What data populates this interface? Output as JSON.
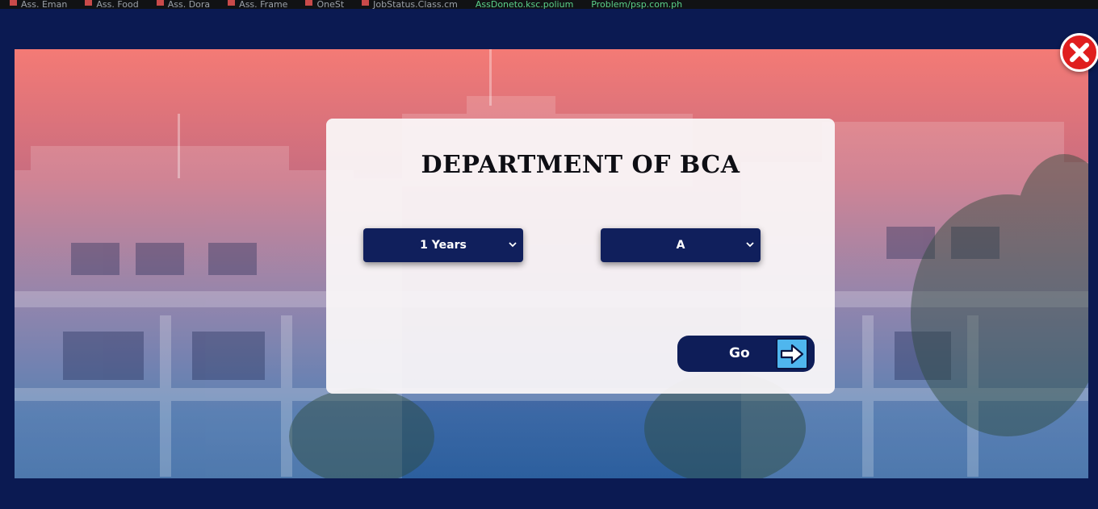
{
  "bookmarks": [
    {
      "label": "Ass. Eman"
    },
    {
      "label": "Ass. Food"
    },
    {
      "label": "Ass. Dora"
    },
    {
      "label": "Ass. Frame"
    },
    {
      "label": "OneSt"
    },
    {
      "label": "JobStatus.Class.cm"
    },
    {
      "label": "AssDoneto.ksc.polium"
    },
    {
      "label": "Problem/psp.com.ph"
    }
  ],
  "dialog": {
    "title": "DEPARTMENT OF BCA",
    "year_select": {
      "value": "1 Years"
    },
    "section_select": {
      "value": "A"
    },
    "go_label": "Go"
  },
  "icons": {
    "close": "close-x-icon",
    "go_arrow": "arrow-right-icon",
    "chevron": "chevron-down-icon"
  },
  "colors": {
    "page_bg": "#0b1a52",
    "select_bg": "#101f5c",
    "button_bg": "#0e1d58",
    "arrow_bg": "#4fb6ee",
    "close_bg": "#e01e1e"
  }
}
